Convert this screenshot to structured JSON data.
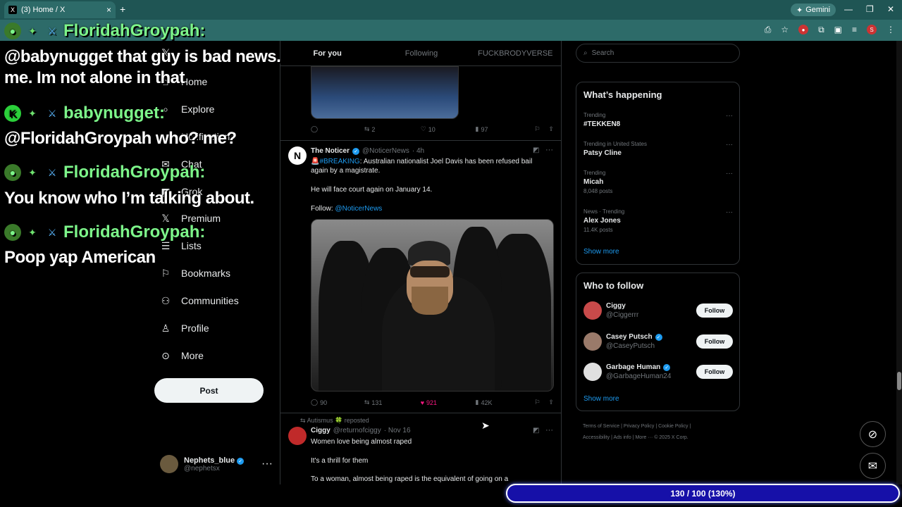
{
  "browser": {
    "tab_title": "(3) Home / X",
    "tab_icon": "X",
    "gemini_label": "Gemini"
  },
  "nav": {
    "items": [
      {
        "label": "Home",
        "icon": "home-icon"
      },
      {
        "label": "Explore",
        "icon": "search-icon"
      },
      {
        "label": "Notifications",
        "icon": "bell-icon"
      },
      {
        "label": "Chat",
        "icon": "mail-icon"
      },
      {
        "label": "Grok",
        "icon": "grok-icon"
      },
      {
        "label": "Premium",
        "icon": "x-icon"
      },
      {
        "label": "Lists",
        "icon": "list-icon"
      },
      {
        "label": "Bookmarks",
        "icon": "bookmark-icon"
      },
      {
        "label": "Communities",
        "icon": "people-icon"
      },
      {
        "label": "Profile",
        "icon": "person-icon"
      },
      {
        "label": "More",
        "icon": "more-circle-icon"
      }
    ],
    "post_label": "Post",
    "account": {
      "name": "Nephets_blue",
      "handle": "@nephetsx"
    }
  },
  "feed": {
    "tabs": [
      "For you",
      "Following",
      "FUCKBRODYVERSE"
    ],
    "tweet0_stats": {
      "replies": "",
      "reposts": "2",
      "likes": "10",
      "views": "97"
    },
    "tweet1": {
      "name": "The Noticer",
      "handle": "@NoticerNews",
      "time": "· 4h",
      "hashtag": "🚨#BREAKING",
      "line1": ": Australian nationalist Joel Davis has been refused bail again by a magistrate.",
      "line2": "He will face court again on January 14.",
      "follow_prefix": "Follow: ",
      "follow_link": "@NoticerNews",
      "stats": {
        "replies": "90",
        "reposts": "131",
        "likes": "921",
        "views": "42K"
      }
    },
    "tweet2": {
      "reposted_by": "Autismus 🍀 reposted",
      "name": "Ciggy",
      "handle": "@returnofciggy",
      "time": "· Nov 16",
      "line1": "Women love being almost raped",
      "line2": "It's a thrill for them",
      "line3": "To a woman, almost being raped is the equivalent of going on a"
    }
  },
  "sidebar": {
    "search_placeholder": "Search",
    "happening_title": "What’s happening",
    "trends": [
      {
        "context": "Trending",
        "title": "#TEKKEN8",
        "count": ""
      },
      {
        "context": "Trending in United States",
        "title": "Patsy Cline",
        "count": ""
      },
      {
        "context": "Trending",
        "title": "Micah",
        "count": "8,048 posts"
      },
      {
        "context": "News · Trending",
        "title": "Alex Jones",
        "count": "11.4K posts"
      }
    ],
    "show_more": "Show more",
    "wtf_title": "Who to follow",
    "who_to_follow": [
      {
        "name": "Ciggy",
        "handle": "@Ciggerrr",
        "verified": false
      },
      {
        "name": "Casey Putsch",
        "handle": "@CaseyPutsch",
        "verified": true
      },
      {
        "name": "Garbage Human",
        "handle": "@GarbageHuman24",
        "verified": true
      }
    ],
    "follow_label": "Follow",
    "footer": [
      "Terms of Service",
      "Privacy Policy",
      "Cookie Policy",
      "Accessibility",
      "Ads info",
      "More ···",
      "© 2025 X Corp."
    ]
  },
  "chat": [
    {
      "user": "FloridahGroypah:",
      "message": "@babynugget that guy is bad news. Trust me. Im not alone in that"
    },
    {
      "user": "babynugget:",
      "message": "@FloridahGroypah who? me?"
    },
    {
      "user": "FloridahGroypah:",
      "message": "You know who I’m talking about."
    },
    {
      "user": "FloridahGroypah:",
      "message": "Poop yap American"
    }
  ],
  "progress": {
    "label": "130 / 100 (130%)",
    "fraction": 1.3
  },
  "colors": {
    "accent": "#1d9bf0",
    "chat_name": "#7df58a",
    "progress_bar": "#1610a8",
    "like_active": "#f91880"
  }
}
